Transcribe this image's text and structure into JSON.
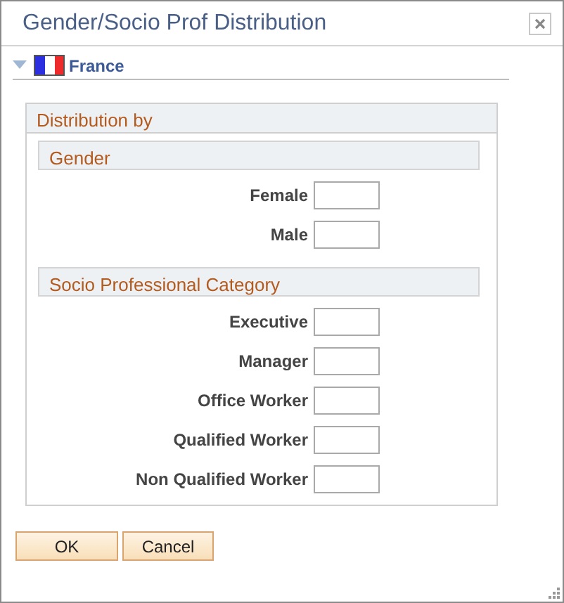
{
  "window": {
    "title": "Gender/Socio Prof Distribution"
  },
  "country": {
    "name": "France",
    "expanded": true
  },
  "group": {
    "title": "Distribution by",
    "sections": [
      {
        "title": "Gender",
        "fields": [
          {
            "label": "Female"
          },
          {
            "label": "Male"
          }
        ]
      },
      {
        "title": "Socio Professional Category",
        "fields": [
          {
            "label": "Executive"
          },
          {
            "label": "Manager"
          },
          {
            "label": "Office Worker"
          },
          {
            "label": "Qualified Worker"
          },
          {
            "label": "Non Qualified Worker"
          }
        ]
      }
    ]
  },
  "buttons": [
    "OK",
    "Cancel"
  ]
}
